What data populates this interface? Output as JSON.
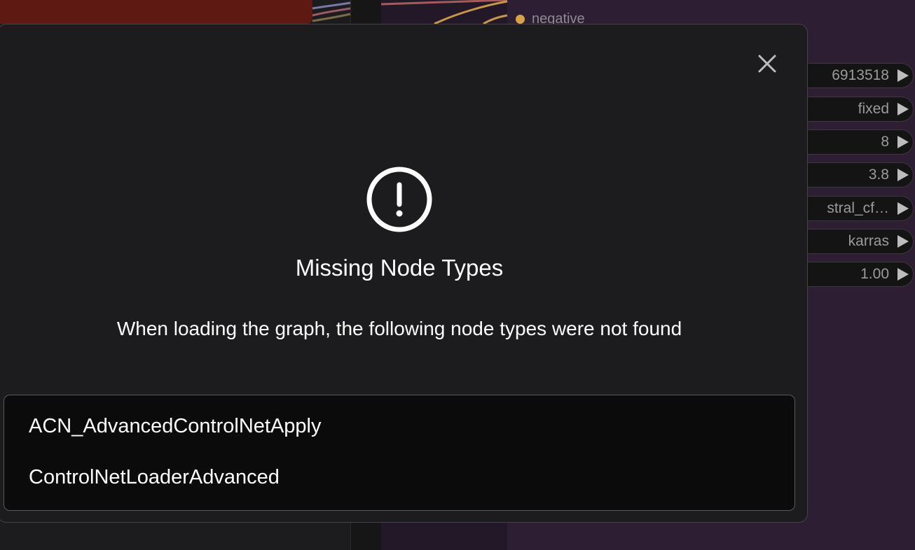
{
  "background": {
    "node_input_label": "negative",
    "widgets": [
      {
        "value": "6913518"
      },
      {
        "value": "fixed"
      },
      {
        "value": "8"
      },
      {
        "value": "3.8"
      },
      {
        "value": "stral_cf…"
      },
      {
        "value": "karras"
      },
      {
        "value": "1.00"
      }
    ]
  },
  "dialog": {
    "title": "Missing Node Types",
    "message": "When loading the graph, the following node types were not found",
    "missing_nodes": [
      "ACN_AdvancedControlNetApply",
      "ControlNetLoaderAdvanced"
    ],
    "close_icon": "close-icon",
    "alert_icon": "exclamation-circle-icon"
  },
  "colors": {
    "dialog_bg": "#1c1c1e",
    "list_bg": "#0b0b0c",
    "text": "#ffffff",
    "wire_orange": "#d8a247",
    "node_red": "#5e1a12",
    "node_purple": "#2d1e33"
  }
}
